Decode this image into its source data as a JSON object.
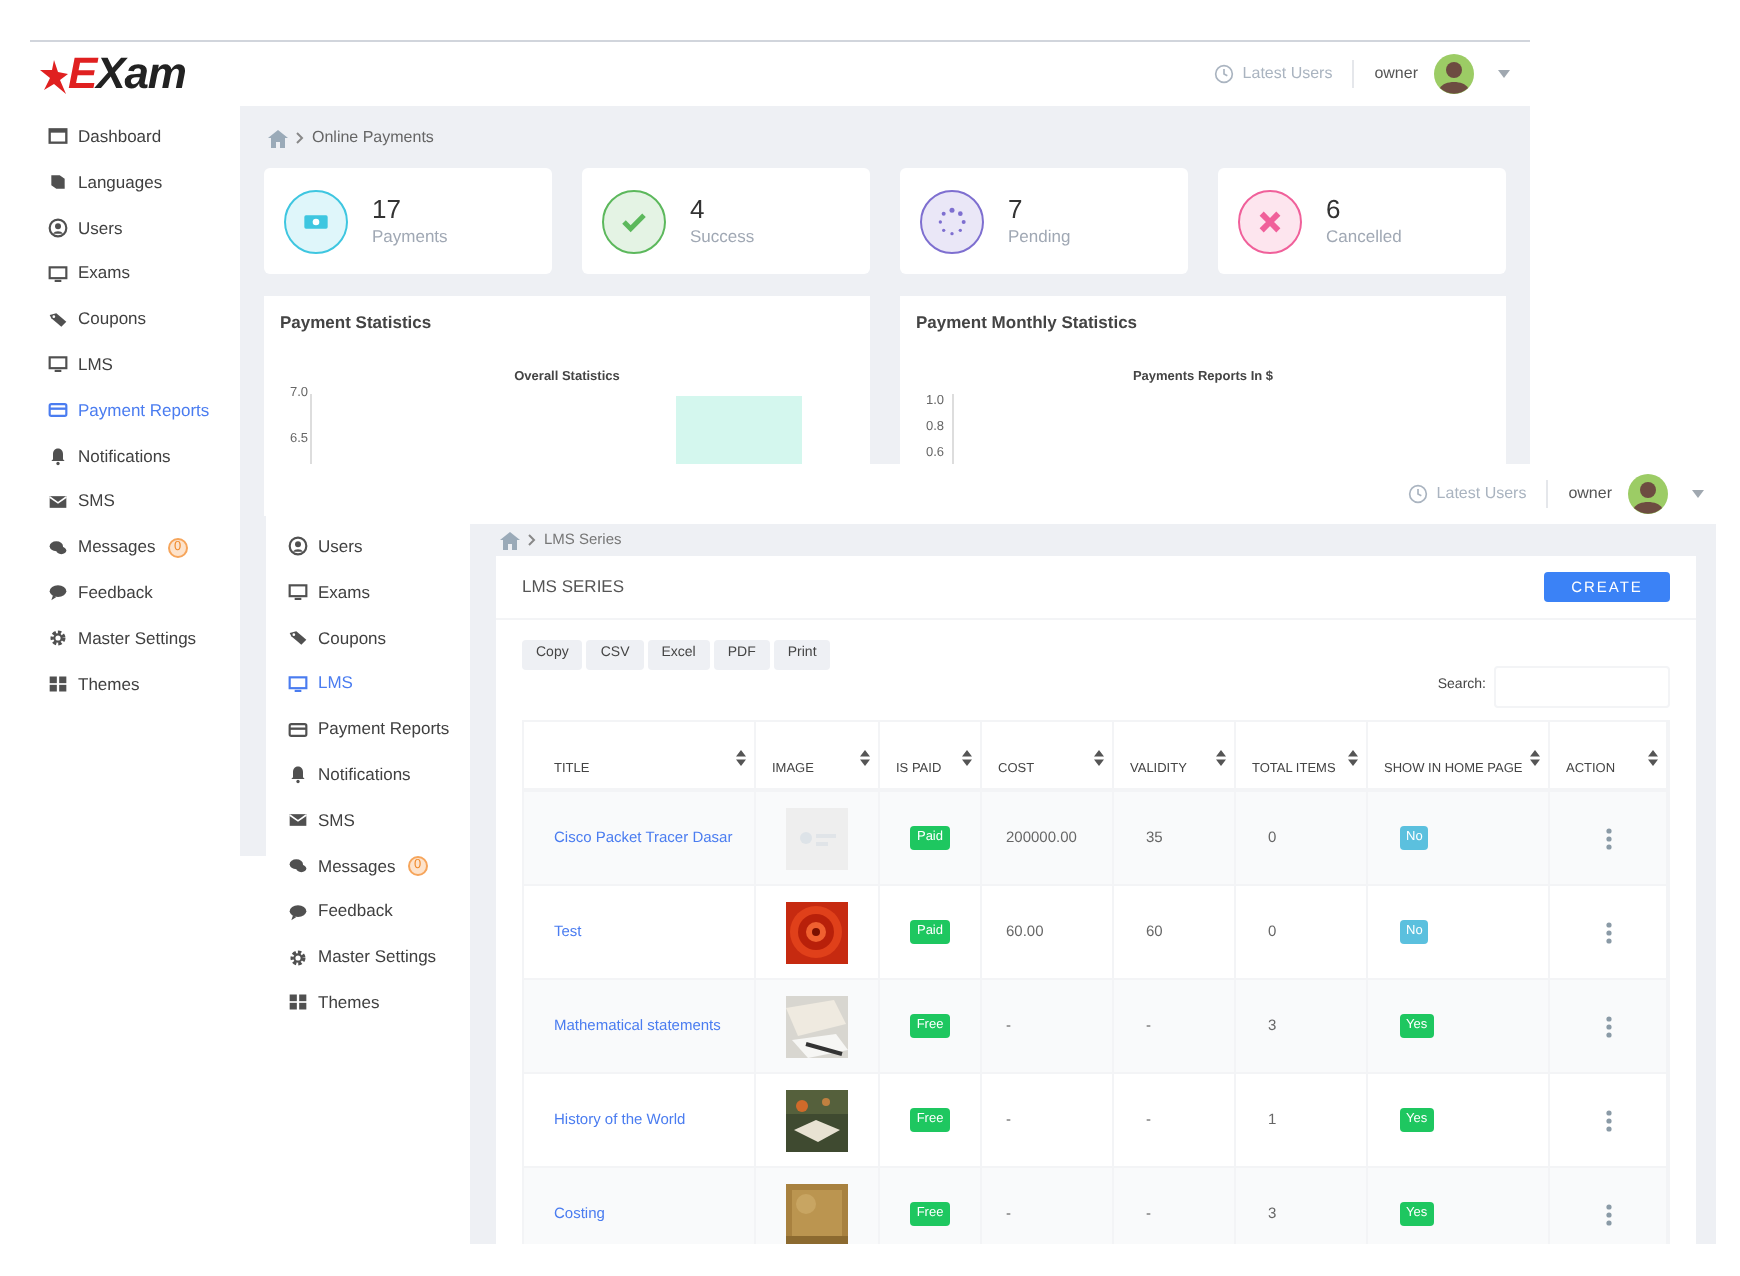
{
  "back_window": {
    "logo": "EXam",
    "header": {
      "latest_users": "Latest Users",
      "user": "owner"
    },
    "sidebar": {
      "items": [
        {
          "label": "Dashboard",
          "selected": false
        },
        {
          "label": "Languages",
          "selected": false
        },
        {
          "label": "Users",
          "selected": false
        },
        {
          "label": "Exams",
          "selected": false
        },
        {
          "label": "Coupons",
          "selected": false
        },
        {
          "label": "LMS",
          "selected": false
        },
        {
          "label": "Payment Reports",
          "selected": true
        },
        {
          "label": "Notifications",
          "selected": false
        },
        {
          "label": "SMS",
          "selected": false
        },
        {
          "label": "Messages",
          "selected": false,
          "badge": "0"
        },
        {
          "label": "Feedback",
          "selected": false
        },
        {
          "label": "Master Settings",
          "selected": false
        },
        {
          "label": "Themes",
          "selected": false
        }
      ]
    },
    "breadcrumb": "Online Payments",
    "stat_cards": [
      {
        "kind": "payments",
        "value": "17",
        "label": "Payments",
        "color": "#3ec6e0"
      },
      {
        "kind": "success",
        "value": "4",
        "label": "Success",
        "color": "#5cb85c"
      },
      {
        "kind": "pending",
        "value": "7",
        "label": "Pending",
        "color": "#7e6fd0"
      },
      {
        "kind": "cancelled",
        "value": "6",
        "label": "Cancelled",
        "color": "#f0609a"
      }
    ],
    "panels": [
      {
        "title": "Payment Statistics",
        "chart_title": "Overall Statistics",
        "kind": "bar",
        "y_ticks": [
          "7.0",
          "6.5"
        ]
      },
      {
        "title": "Payment Monthly Statistics",
        "chart_title": "Payments Reports In $",
        "kind": "line",
        "y_ticks": [
          "1.0",
          "0.8",
          "0.6"
        ]
      }
    ]
  },
  "front_window": {
    "header": {
      "latest_users": "Latest Users",
      "user": "owner"
    },
    "sidebar": {
      "items": [
        {
          "label": "Users",
          "selected": false
        },
        {
          "label": "Exams",
          "selected": false
        },
        {
          "label": "Coupons",
          "selected": false
        },
        {
          "label": "LMS",
          "selected": true
        },
        {
          "label": "Payment Reports",
          "selected": false
        },
        {
          "label": "Notifications",
          "selected": false
        },
        {
          "label": "SMS",
          "selected": false
        },
        {
          "label": "Messages",
          "selected": false,
          "badge": "0"
        },
        {
          "label": "Feedback",
          "selected": false
        },
        {
          "label": "Master Settings",
          "selected": false
        },
        {
          "label": "Themes",
          "selected": false
        }
      ]
    },
    "breadcrumb": "LMS Series",
    "panel": {
      "title": "LMS SERIES",
      "create_button": "CREATE",
      "export_buttons": [
        "Copy",
        "CSV",
        "Excel",
        "PDF",
        "Print"
      ],
      "search": {
        "label": "Search:"
      },
      "table": {
        "columns": [
          "TITLE",
          "IMAGE",
          "IS PAID",
          "COST",
          "VALIDITY",
          "TOTAL ITEMS",
          "SHOW IN HOME PAGE",
          "ACTION"
        ],
        "rows": [
          {
            "title": "Cisco Packet Tracer Dasar",
            "is_paid": "Paid",
            "cost": "200000.00",
            "validity": "35",
            "total_items": "0",
            "show_home": {
              "text": "No",
              "color": "#5bc0de"
            }
          },
          {
            "title": "Test",
            "is_paid": "Paid",
            "cost": "60.00",
            "validity": "60",
            "total_items": "0",
            "show_home": {
              "text": "No",
              "color": "#5bc0de"
            }
          },
          {
            "title": "Mathematical statements",
            "is_paid": "Free",
            "cost": "-",
            "validity": "-",
            "total_items": "3",
            "show_home": {
              "text": "Yes",
              "color": "#1ec760"
            }
          },
          {
            "title": "History of the World",
            "is_paid": "Free",
            "cost": "-",
            "validity": "-",
            "total_items": "1",
            "show_home": {
              "text": "Yes",
              "color": "#1ec760"
            }
          },
          {
            "title": "Costing",
            "is_paid": "Free",
            "cost": "-",
            "validity": "-",
            "total_items": "3",
            "show_home": {
              "text": "Yes",
              "color": "#1ec760"
            }
          }
        ]
      }
    }
  }
}
